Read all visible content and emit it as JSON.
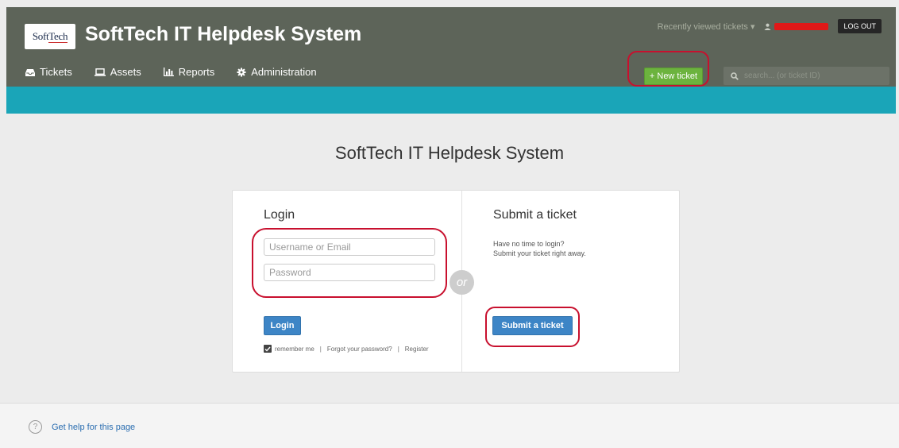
{
  "header": {
    "logo_text_soft": "Soft",
    "logo_text_tech": "Tech",
    "title": "SoftTech IT Helpdesk System",
    "recently_viewed": "Recently viewed tickets",
    "recently_viewed_caret": "▾",
    "logout": "LOG OUT",
    "new_ticket": "+ New ticket",
    "search_placeholder": "search... (or ticket ID)"
  },
  "nav": {
    "tickets": "Tickets",
    "assets": "Assets",
    "reports": "Reports",
    "administration": "Administration"
  },
  "main": {
    "page_title": "SoftTech IT Helpdesk System",
    "or": "or"
  },
  "login": {
    "title": "Login",
    "username_placeholder": "Username or Email",
    "password_placeholder": "Password",
    "button": "Login",
    "remember_me": "remember me",
    "separator": "|",
    "forgot_password": "Forgot your password?",
    "register": "Register"
  },
  "submit": {
    "title": "Submit a ticket",
    "text_line1": "Have no time to login?",
    "text_line2": "Submit your ticket right away.",
    "button": "Submit a ticket"
  },
  "footer": {
    "help_icon": "?",
    "help": "Get help for this page"
  },
  "colors": {
    "header_bg": "#5d6459",
    "teal_bar": "#1aa5b8",
    "new_ticket_green": "#6cb33e",
    "primary_blue": "#3d85c6",
    "annotation_red": "#c8102e",
    "redacted_username": "#e01818"
  }
}
